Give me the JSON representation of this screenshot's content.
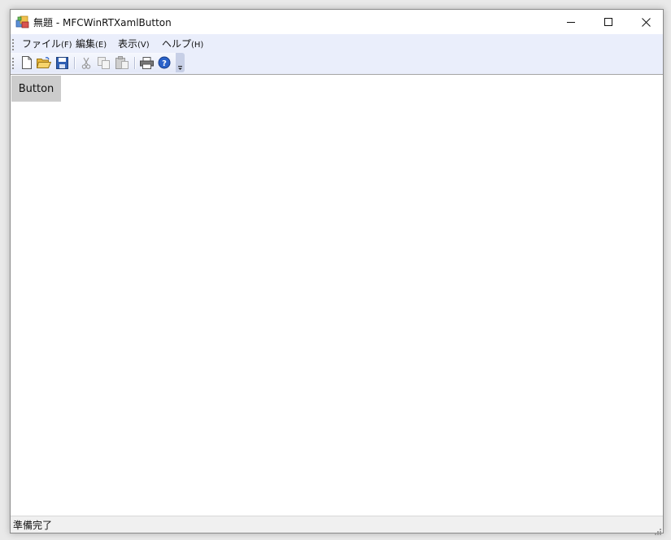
{
  "window": {
    "title": "無題 - MFCWinRTXamlButton"
  },
  "menu": {
    "items": [
      {
        "label": "ファイル",
        "accel": "(F)"
      },
      {
        "label": "編集",
        "accel": "(E)"
      },
      {
        "label": "表示",
        "accel": "(V)"
      },
      {
        "label": "ヘルプ",
        "accel": "(H)"
      }
    ]
  },
  "toolbar": {
    "buttons": [
      "new-file-icon",
      "open-folder-icon",
      "save-icon",
      "cut-icon",
      "copy-icon",
      "paste-icon",
      "print-icon",
      "help-icon"
    ]
  },
  "content": {
    "button_label": "Button"
  },
  "status": {
    "text": "準備完了"
  },
  "colors": {
    "menubar_bg": "#eaeefb",
    "button_bg": "#cccccc",
    "help_blue": "#2a62c9"
  }
}
